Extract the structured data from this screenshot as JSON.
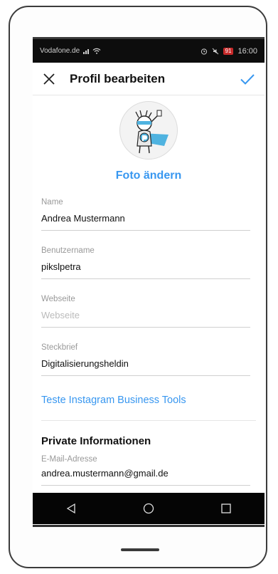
{
  "status_bar": {
    "carrier": "Vodafone.de",
    "battery": "91",
    "time": "16:00"
  },
  "header": {
    "title": "Profil bearbeiten"
  },
  "profile": {
    "change_photo_label": "Foto ändern"
  },
  "fields": {
    "name_label": "Name",
    "name_value": "Andrea Mustermann",
    "username_label": "Benutzername",
    "username_value": "pikslpetra",
    "website_label": "Webseite",
    "website_placeholder": "Webseite",
    "bio_label": "Steckbrief",
    "bio_value": "Digitalisierungsheldin"
  },
  "business_link": "Teste Instagram Business Tools",
  "private": {
    "section_title": "Private Informationen",
    "email_label": "E-Mail-Adresse",
    "email_value": "andrea.mustermann@gmail.de"
  },
  "colors": {
    "accent": "#3897f0",
    "statusbar_bg": "#0d0d0d",
    "navbar_bg": "#050505"
  },
  "icons": {
    "close": "close-icon",
    "confirm": "check-icon",
    "back": "back-triangle-icon",
    "home": "home-circle-icon",
    "recents": "recents-square-icon"
  }
}
